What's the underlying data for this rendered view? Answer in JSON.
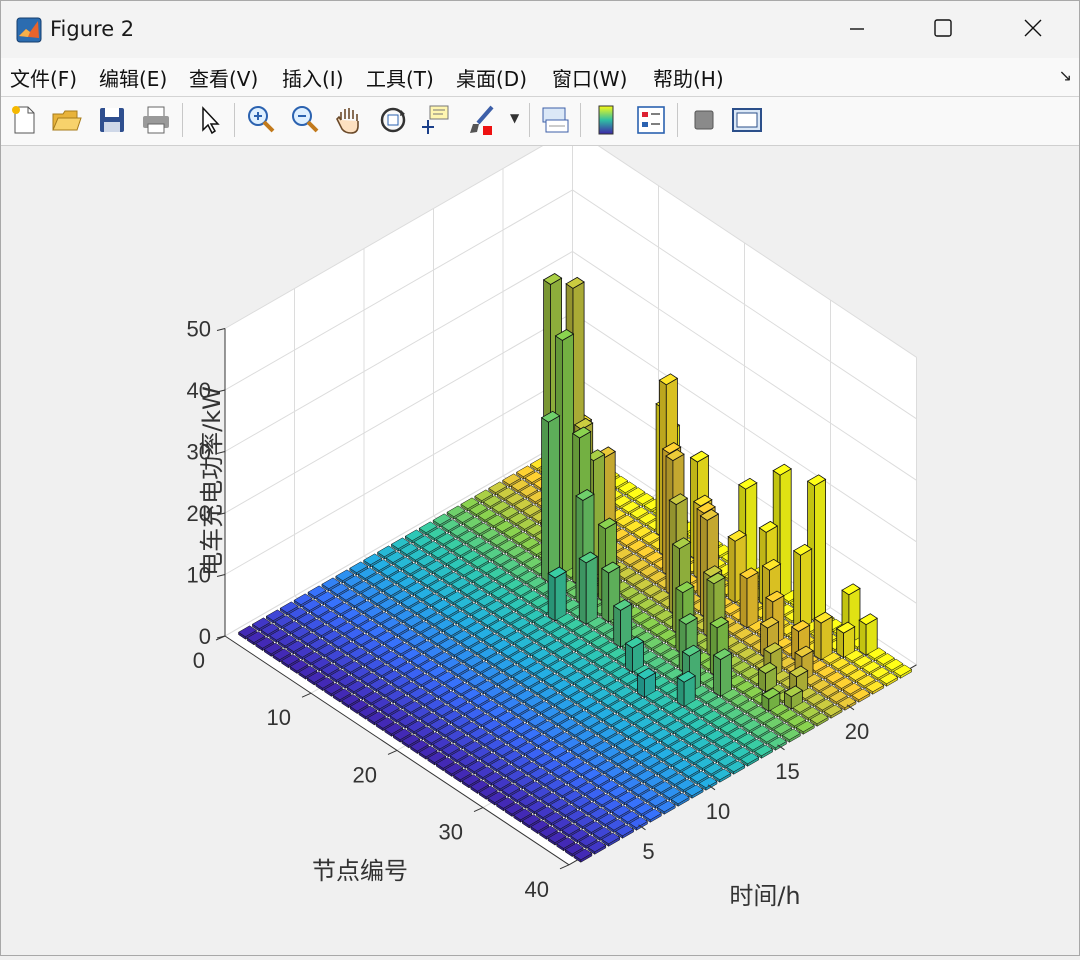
{
  "window": {
    "title": "Figure 2"
  },
  "menu": [
    {
      "label": "文件(F)"
    },
    {
      "label": "编辑(E)"
    },
    {
      "label": "查看(V)"
    },
    {
      "label": "插入(I)"
    },
    {
      "label": "工具(T)"
    },
    {
      "label": "桌面(D)"
    },
    {
      "label": "窗口(W)"
    },
    {
      "label": "帮助(H)"
    }
  ],
  "toolbar": [
    {
      "icon": "new-figure-icon"
    },
    {
      "icon": "open-file-icon"
    },
    {
      "icon": "save-icon"
    },
    {
      "icon": "print-icon"
    },
    {
      "icon": "select-pointer-icon"
    },
    {
      "icon": "zoom-in-icon"
    },
    {
      "icon": "zoom-out-icon"
    },
    {
      "icon": "pan-hand-icon"
    },
    {
      "icon": "rotate-3d-icon"
    },
    {
      "icon": "data-cursor-icon"
    },
    {
      "icon": "brush-icon"
    },
    {
      "icon": "link-plot-icon"
    },
    {
      "icon": "colorbar-icon"
    },
    {
      "icon": "legend-icon"
    },
    {
      "icon": "hide-plot-tools-icon"
    },
    {
      "icon": "show-plot-tools-icon"
    }
  ],
  "chart_data": {
    "type": "bar3",
    "zlabel": "电车充电功率/kW",
    "ylabel": "节点编号",
    "xlabel": "时间/h",
    "x_range": [
      1,
      24
    ],
    "y_range": [
      1,
      40
    ],
    "zlim": [
      0,
      50
    ],
    "x_ticks": [
      5,
      10,
      15,
      20
    ],
    "y_ticks": [
      0,
      10,
      20,
      30,
      40
    ],
    "z_ticks": [
      0,
      10,
      20,
      30,
      40,
      50
    ],
    "colormap": "parula",
    "colors": {
      "parula_low": "#3e26a8",
      "parula_high": "#f9fb15",
      "bar_edge": "#000000",
      "grid": "#dcdcdc"
    },
    "grid": true,
    "bars": [
      {
        "x": 17,
        "y": 12,
        "z": 38
      },
      {
        "x": 19,
        "y": 10,
        "z": 42
      },
      {
        "x": 18,
        "y": 9,
        "z": 43
      },
      {
        "x": 16,
        "y": 12,
        "z": 26
      },
      {
        "x": 17,
        "y": 14,
        "z": 24
      },
      {
        "x": 20,
        "y": 8,
        "z": 26
      },
      {
        "x": 19,
        "y": 11,
        "z": 20
      },
      {
        "x": 16,
        "y": 16,
        "z": 17
      },
      {
        "x": 21,
        "y": 7,
        "z": 11
      },
      {
        "x": 22,
        "y": 6,
        "z": 12
      },
      {
        "x": 20,
        "y": 12,
        "z": 15
      },
      {
        "x": 18,
        "y": 14,
        "z": 19
      },
      {
        "x": 17,
        "y": 17,
        "z": 12
      },
      {
        "x": 16,
        "y": 19,
        "z": 8
      },
      {
        "x": 15,
        "y": 22,
        "z": 6
      },
      {
        "x": 14,
        "y": 25,
        "z": 4
      },
      {
        "x": 13,
        "y": 28,
        "z": 3
      },
      {
        "x": 15,
        "y": 18,
        "z": 10
      },
      {
        "x": 14,
        "y": 16,
        "z": 7
      },
      {
        "x": 22,
        "y": 16,
        "z": 28
      },
      {
        "x": 23,
        "y": 14,
        "z": 21
      },
      {
        "x": 21,
        "y": 18,
        "z": 20
      },
      {
        "x": 20,
        "y": 20,
        "z": 22
      },
      {
        "x": 19,
        "y": 22,
        "z": 18
      },
      {
        "x": 18,
        "y": 24,
        "z": 14
      },
      {
        "x": 17,
        "y": 26,
        "z": 10
      },
      {
        "x": 16,
        "y": 28,
        "z": 8
      },
      {
        "x": 15,
        "y": 30,
        "z": 6
      },
      {
        "x": 14,
        "y": 31,
        "z": 4
      },
      {
        "x": 22,
        "y": 20,
        "z": 12
      },
      {
        "x": 21,
        "y": 22,
        "z": 14
      },
      {
        "x": 20,
        "y": 24,
        "z": 16
      },
      {
        "x": 19,
        "y": 26,
        "z": 10
      },
      {
        "x": 18,
        "y": 28,
        "z": 12
      },
      {
        "x": 17,
        "y": 30,
        "z": 8
      },
      {
        "x": 16,
        "y": 32,
        "z": 6
      },
      {
        "x": 24,
        "y": 13,
        "z": 15
      },
      {
        "x": 23,
        "y": 18,
        "z": 16
      },
      {
        "x": 22,
        "y": 24,
        "z": 10
      },
      {
        "x": 21,
        "y": 27,
        "z": 8
      },
      {
        "x": 24,
        "y": 22,
        "z": 14
      },
      {
        "x": 23,
        "y": 26,
        "z": 12
      },
      {
        "x": 22,
        "y": 28,
        "z": 9
      },
      {
        "x": 21,
        "y": 30,
        "z": 7
      },
      {
        "x": 20,
        "y": 31,
        "z": 5
      },
      {
        "x": 19,
        "y": 33,
        "z": 4
      },
      {
        "x": 18,
        "y": 34,
        "z": 3
      },
      {
        "x": 24,
        "y": 30,
        "z": 22
      },
      {
        "x": 24,
        "y": 26,
        "z": 20
      },
      {
        "x": 23,
        "y": 30,
        "z": 12
      },
      {
        "x": 24,
        "y": 34,
        "z": 8
      },
      {
        "x": 24,
        "y": 36,
        "z": 5
      },
      {
        "x": 23,
        "y": 35,
        "z": 4
      },
      {
        "x": 22,
        "y": 34,
        "z": 6
      },
      {
        "x": 21,
        "y": 33,
        "z": 5
      },
      {
        "x": 20,
        "y": 35,
        "z": 4
      },
      {
        "x": 19,
        "y": 36,
        "z": 3
      },
      {
        "x": 18,
        "y": 37,
        "z": 2
      },
      {
        "x": 17,
        "y": 36,
        "z": 2
      }
    ]
  }
}
